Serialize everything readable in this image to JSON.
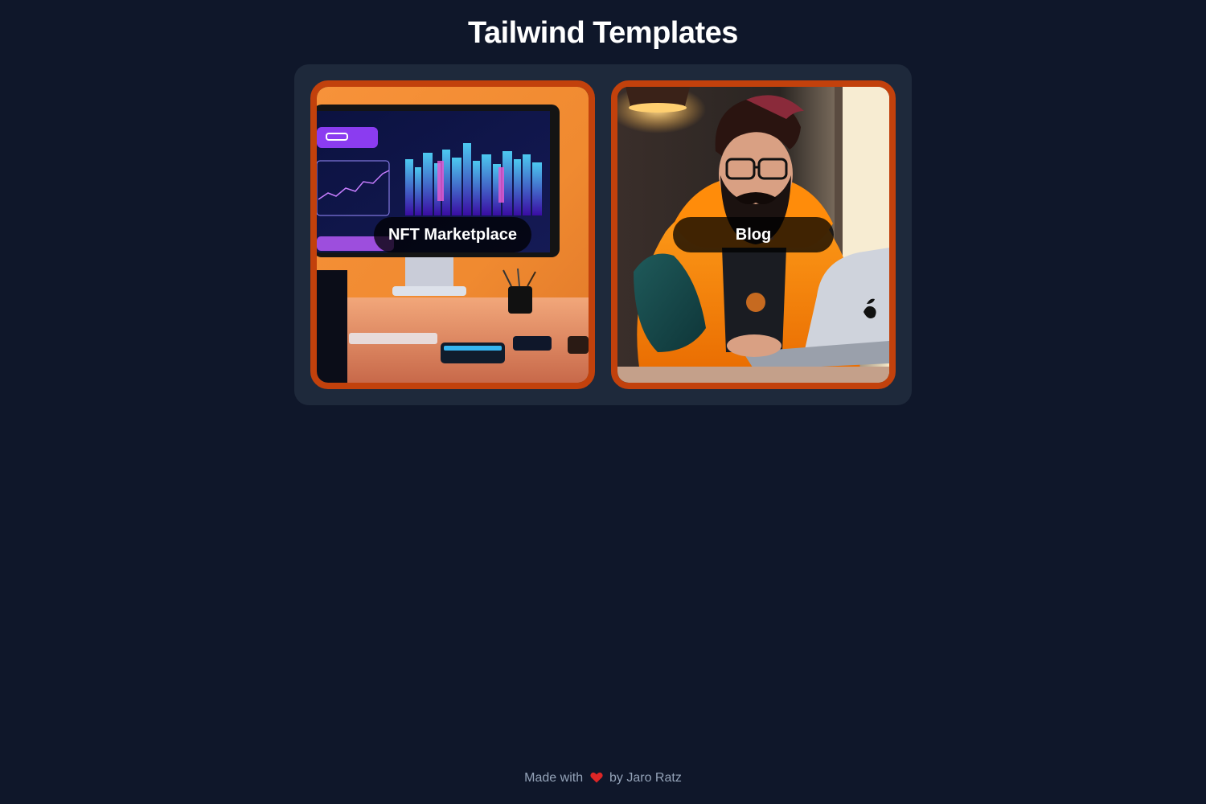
{
  "header": {
    "title": "Tailwind Templates"
  },
  "templates": [
    {
      "label": "NFT Marketplace",
      "image": "computer-monitor-dashboard-illustration"
    },
    {
      "label": "Blog",
      "image": "bearded-man-with-laptop-illustration"
    }
  ],
  "footer": {
    "prefix": "Made with",
    "icon": "heart-icon",
    "suffix": "by Jaro Ratz"
  },
  "colors": {
    "background": "#0f172a",
    "panel": "#1e293b",
    "card_border": "#c2410c",
    "heart": "#dc2626",
    "footer_text": "#94a3b8"
  }
}
